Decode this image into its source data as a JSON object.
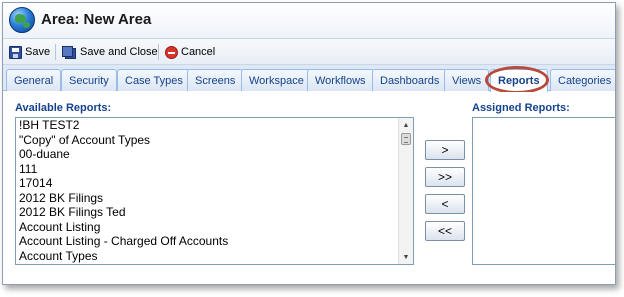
{
  "window": {
    "title": "Area: New Area",
    "icon": "globe-icon"
  },
  "toolbar": {
    "save_label": "Save",
    "save_close_label": "Save and Close",
    "cancel_label": "Cancel"
  },
  "tabs": [
    {
      "label": "General"
    },
    {
      "label": "Security"
    },
    {
      "label": "Case Types"
    },
    {
      "label": "Screens"
    },
    {
      "label": "Workspace"
    },
    {
      "label": "Workflows"
    },
    {
      "label": "Dashboards"
    },
    {
      "label": "Views"
    },
    {
      "label": "Reports",
      "active": true
    },
    {
      "label": "Categories"
    }
  ],
  "available": {
    "label": "Available Reports:",
    "items": [
      "!BH TEST2",
      "\"Copy\" of Account Types",
      "00-duane",
      "111",
      "17014",
      "2012 BK Filings",
      "2012 BK Filings Ted",
      "Account Listing",
      "Account Listing - Charged Off Accounts",
      "Account Types"
    ]
  },
  "assigned": {
    "label": "Assigned Reports:",
    "items": []
  },
  "move_buttons": {
    "add": ">",
    "add_all": ">>",
    "remove": "<",
    "remove_all": "<<"
  },
  "colors": {
    "tab_text": "#15428b",
    "highlight_ring": "#b84a3c",
    "cancel_icon": "#d9342b"
  }
}
